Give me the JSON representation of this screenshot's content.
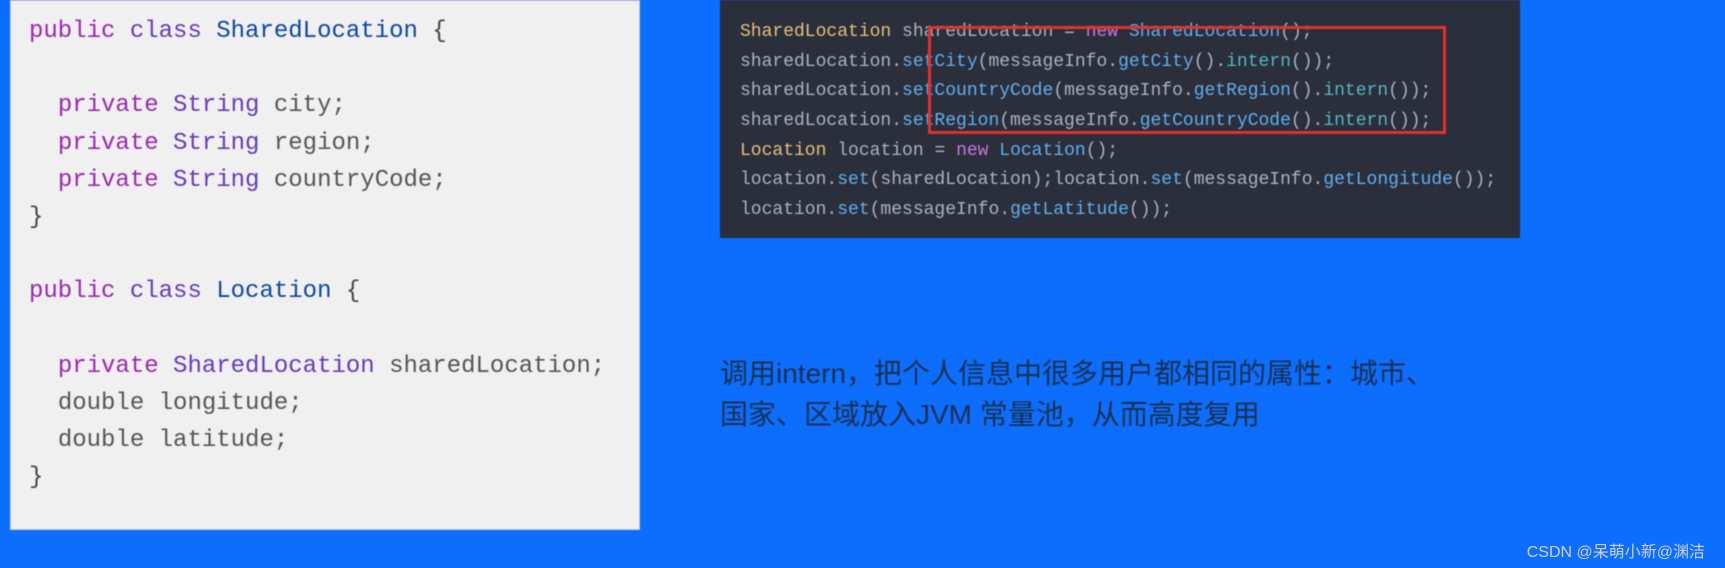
{
  "left_code": {
    "l1": {
      "kw1": "public",
      "kw2": "class",
      "name": "SharedLocation",
      "brace": "{"
    },
    "l2": "",
    "l3": {
      "kw": "private",
      "type": "String",
      "name": "city;"
    },
    "l4": {
      "kw": "private",
      "type": "String",
      "name": "region;"
    },
    "l5": {
      "kw": "private",
      "type": "String",
      "name": "countryCode;"
    },
    "l6": "}",
    "l7": "",
    "l8": {
      "kw1": "public",
      "kw2": "class",
      "name": "Location",
      "brace": "{"
    },
    "l9": "",
    "l10": {
      "kw": "private",
      "type": "SharedLocation",
      "name": "sharedLocation;"
    },
    "l11": {
      "type": "double",
      "name": "longitude;"
    },
    "l12": {
      "type": "double",
      "name": "latitude;"
    },
    "l13": "}"
  },
  "right_code": {
    "r1": {
      "type": "SharedLocation",
      "var": "sharedLocation",
      "eq": " = ",
      "kw": "new",
      "call": "SharedLocation",
      "end": "();"
    },
    "r2": {
      "obj": "sharedLocation.",
      "m1": "setCity",
      "p1": "(messageInfo.",
      "m2": "getCity",
      "p2": "().",
      "m3": "intern",
      "end": "());"
    },
    "r3": {
      "obj": "sharedLocation.",
      "m1": "setCountryCode",
      "p1": "(messageInfo.",
      "m2": "getRegion",
      "p2": "().",
      "m3": "intern",
      "end": "());"
    },
    "r4": {
      "obj": "sharedLocation.",
      "m1": "setRegion",
      "p1": "(messageInfo.",
      "m2": "getCountryCode",
      "p2": "().",
      "m3": "intern",
      "end": "());"
    },
    "r5": {
      "type": "Location",
      "var": "location",
      "eq": " = ",
      "kw": "new",
      "call": "Location",
      "end": "();"
    },
    "r6": {
      "a": "location.",
      "m1": "set",
      "p1": "(sharedLocation);",
      "b": "location.",
      "m2": "set",
      "p2": "(messageInfo.",
      "m3": "getLongitude",
      "end": "());"
    },
    "r7": {
      "a": "location.",
      "m1": "set",
      "p1": "(messageInfo.",
      "m2": "getLatitude",
      "end": "());"
    }
  },
  "explain": {
    "line1": "调用intern，把个人信息中很多用户都相同的属性：城市、",
    "line2": "国家、区域放入JVM 常量池，从而高度复用"
  },
  "credit": "CSDN @呆萌小新@渊洁"
}
